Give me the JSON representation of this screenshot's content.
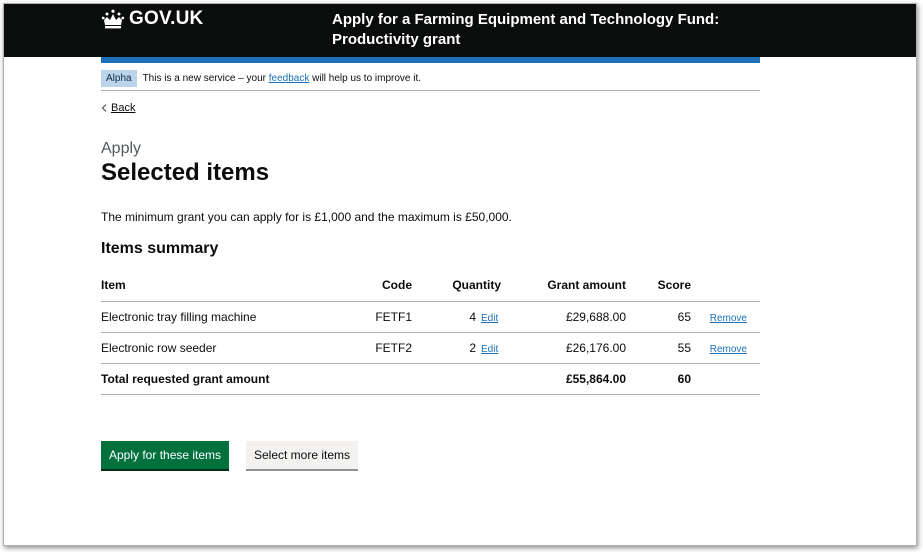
{
  "header": {
    "logo_text": "GOV.UK",
    "service_name": "Apply for a Farming Equipment and Technology Fund: Productivity grant"
  },
  "phase_banner": {
    "tag": "Alpha",
    "text_before": "This is a new service – your ",
    "link": "feedback",
    "text_after": " will help us to improve it."
  },
  "back_link": "Back",
  "caption": "Apply",
  "title": "Selected items",
  "lede": "The minimum grant you can apply for is £1,000 and the maximum is £50,000.",
  "summary_heading": "Items summary",
  "table": {
    "headers": {
      "item": "Item",
      "code": "Code",
      "quantity": "Quantity",
      "grant": "Grant amount",
      "score": "Score"
    },
    "rows": [
      {
        "item": "Electronic tray filling machine",
        "code": "FETF1",
        "quantity": "4",
        "edit": "Edit",
        "grant": "£29,688.00",
        "score": "65",
        "remove": "Remove"
      },
      {
        "item": "Electronic row seeder",
        "code": "FETF2",
        "quantity": "2",
        "edit": "Edit",
        "grant": "£26,176.00",
        "score": "55",
        "remove": "Remove"
      }
    ],
    "total": {
      "label": "Total requested grant amount",
      "grant": "£55,864.00",
      "score": "60"
    }
  },
  "buttons": {
    "apply": "Apply for these items",
    "select_more": "Select more items"
  },
  "colors": {
    "header_bg": "#0b0c0c",
    "accent_blue": "#1d70b8",
    "primary_button": "#00703c",
    "tag_bg": "#bbd4ea"
  },
  "icons": {
    "logo": "crown-icon",
    "back": "chevron-left-icon"
  }
}
